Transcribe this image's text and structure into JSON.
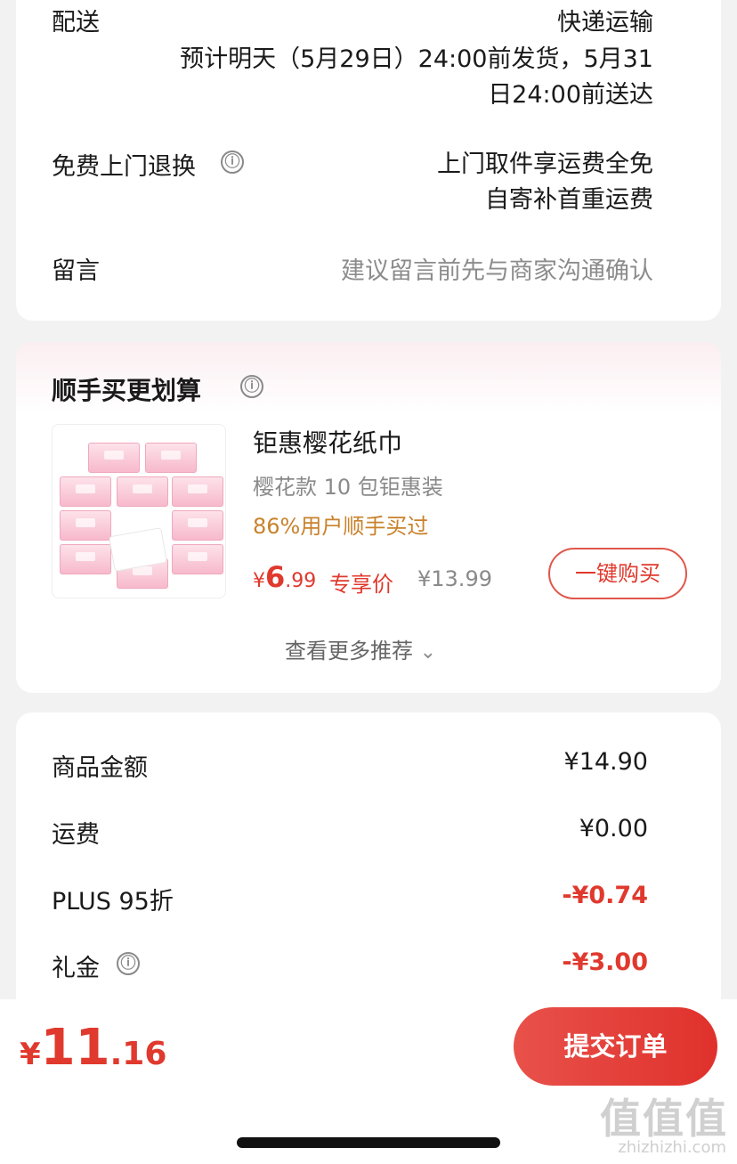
{
  "delivery": {
    "label": "配送",
    "method": "快递运输",
    "eta_line1": "预计明天（5月29日）24:00前发货，5月31",
    "eta_line2": "日24:00前送达"
  },
  "returns": {
    "label": "免费上门退换",
    "info_icon": "ⓘ",
    "line1": "上门取件享运费全免",
    "line2": "自寄补首重运费"
  },
  "message": {
    "label": "留言",
    "placeholder": "建议留言前先与商家沟通确认"
  },
  "addon": {
    "title": "顺手买更划算",
    "info_icon": "ⓘ",
    "product": {
      "name": "钜惠樱花纸巾",
      "spec": "樱花款 10 包钜惠装",
      "social_proof": "86%用户顺手买过",
      "price_symbol": "¥",
      "price_int": "6",
      "price_dec": ".99",
      "price_tag": "专享价",
      "orig_price": "¥13.99",
      "buy_label": "一键购买"
    },
    "more_label": "查看更多推荐",
    "more_icon": "⌄"
  },
  "summary": {
    "rows": [
      {
        "label": "商品金额",
        "value": "¥14.90"
      },
      {
        "label": "运费",
        "value": "¥0.00"
      },
      {
        "label": "PLUS 95折",
        "value": "-¥0.74"
      },
      {
        "label": "礼金",
        "value": "-¥3.00"
      }
    ],
    "info_icon": "ⓘ"
  },
  "footer": {
    "total_symbol": "¥",
    "total_int": "11",
    "total_dec": ".16",
    "submit_label": "提交订单",
    "watermark": "值值值",
    "watermark_site": "zhizhizhi.com"
  },
  "colors": {
    "accent_red": "#e0392d",
    "proof_orange": "#c9822b",
    "muted": "#8a8a8a"
  }
}
